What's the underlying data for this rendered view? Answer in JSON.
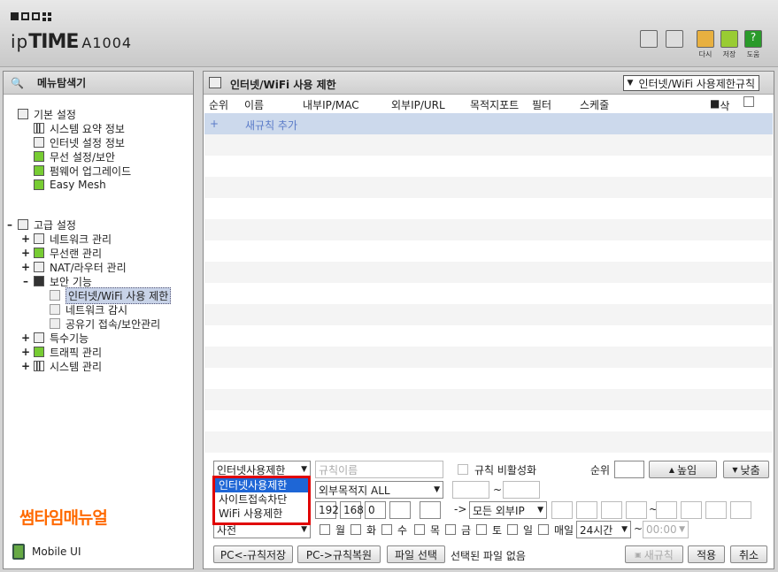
{
  "header": {
    "brand_prefix": "ip",
    "brand_bold": "TIME",
    "model": "A1004",
    "buttons": [
      {
        "label": "다시",
        "icon": "restore-icon"
      },
      {
        "label": "저장",
        "icon": "save-icon"
      },
      {
        "label": "도움",
        "icon": "help-icon"
      }
    ]
  },
  "sidebar": {
    "title": "메뉴탐색기",
    "basic": {
      "label": "기본 설정",
      "items": [
        "시스템 요약 정보",
        "인터넷 설정 정보",
        "무선 설정/보안",
        "펌웨어 업그레이드",
        "Easy Mesh"
      ]
    },
    "advanced": {
      "label": "고급 설정",
      "items": [
        "네트워크 관리",
        "무선랜 관리",
        "NAT/라우터 관리",
        "보안 기능"
      ],
      "security_sub": [
        "인터넷/WiFi 사용 제한",
        "네트워크 감시",
        "공유기 접속/보안관리"
      ],
      "more": [
        "특수기능",
        "트래픽 관리",
        "시스템 관리"
      ]
    },
    "watermark": "썸타임매뉴얼",
    "mobile": "Mobile UI"
  },
  "main": {
    "title": "인터넷/WiFi 사용 제한",
    "rule_select": "인터넷/WiFi 사용제한규칙",
    "columns": [
      "순위",
      "이름",
      "내부IP/MAC",
      "외부IP/URL",
      "목적지포트",
      "필터",
      "스케줄",
      "삭제"
    ],
    "add_rule": "새규칙 추가",
    "add_plus": "+"
  },
  "form": {
    "type_value": "인터넷사용제한",
    "name_placeholder": "규칙이름",
    "disable_label": "규칙 비활성화",
    "rank_label": "순위",
    "up_button": "높임",
    "down_button": "낮춤",
    "dest_value": "외부목적지 ALL",
    "ip_parts": [
      "192",
      "168",
      "0",
      "",
      ""
    ],
    "ext_ip_value": "모든 외부IP",
    "arrow": "->",
    "tilde": "~",
    "schedule_value": "사전",
    "days": [
      "월",
      "화",
      "수",
      "목",
      "금",
      "토",
      "일",
      "매일"
    ],
    "time_value": "24시간",
    "time_end": "00:00",
    "dropdown_options": [
      "인터넷사용제한",
      "사이트접속차단",
      "WiFi 사용제한"
    ],
    "save_pc": "PC<-규칙저장",
    "restore_pc": "PC->규칙복원",
    "file_select": "파일 선택",
    "no_file": "선택된 파일 없음",
    "new_rule": "새규칙",
    "apply": "적용",
    "cancel": "취소"
  }
}
